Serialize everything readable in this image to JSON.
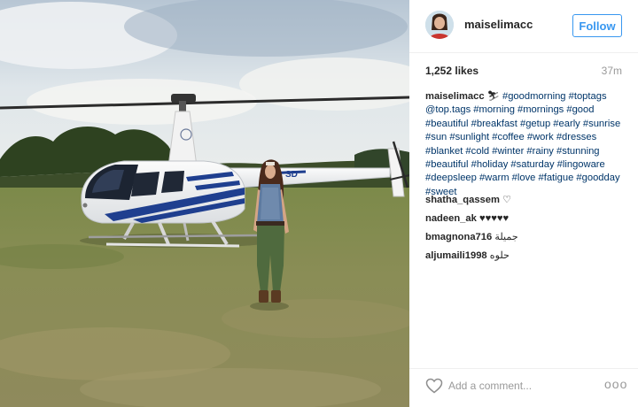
{
  "post": {
    "username": "maiselimacc",
    "follow_label": "Follow",
    "likes": "1,252 likes",
    "time": "37m",
    "caption_user": "maiselimacc",
    "caption_emoji": "⛷",
    "caption_tags": "#goodmorning #toptags @top.tags #morning #mornings #good #beautiful #breakfast #getup #early #sunrise #sun #sunlight #coffee #work #dresses #blanket #cold #winter #rainy #stunning #beautiful #holiday #saturday #lingoware #deepsleep #warm #love #fatigue #goodday #sweet",
    "tail_registration": "SD"
  },
  "comments": [
    {
      "user": "shatha_qassem",
      "text": "♡"
    },
    {
      "user": "nadeen_ak",
      "text": "♥♥♥♥♥"
    },
    {
      "user": "bmagnona716",
      "text": "جميلة"
    },
    {
      "user": "aljumaili1998",
      "text": "حلوه"
    }
  ],
  "footer": {
    "comment_placeholder": "Add a comment...",
    "more_label": "ooo",
    "heart_icon": "heart-outline-icon",
    "more_icon": "more-options-icon"
  },
  "colors": {
    "link": "#003569",
    "follow_blue": "#3897f0",
    "helicopter_stripe": "#1f3f8f"
  }
}
